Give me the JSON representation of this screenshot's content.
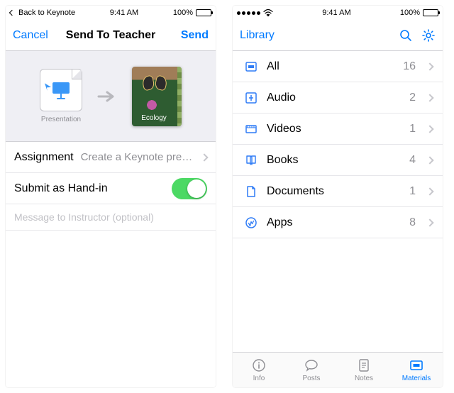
{
  "colors": {
    "tint": "#007aff",
    "toggle_on": "#4cd964",
    "gray": "#8e8e93"
  },
  "left": {
    "status": {
      "back_app": "Back to Keynote",
      "time": "9:41 AM",
      "battery_pct": "100%"
    },
    "nav": {
      "cancel": "Cancel",
      "title": "Send To Teacher",
      "send": "Send"
    },
    "transfer": {
      "source_caption": "Presentation",
      "source_icon": "keynote-icon",
      "arrow_icon": "arrow-right-icon",
      "dest_label": "Ecology",
      "dest_image_alt": "butterfly-flower-course-cover"
    },
    "rows": {
      "assignment_label": "Assignment",
      "assignment_detail": "Create a Keynote presentatio...",
      "submit_label": "Submit as Hand-in",
      "submit_on": true
    },
    "message_placeholder": "Message to Instructor (optional)"
  },
  "right": {
    "status": {
      "time": "9:41 AM",
      "battery_pct": "100%"
    },
    "nav": {
      "title": "Library",
      "search_icon": "search-icon",
      "settings_icon": "gear-icon"
    },
    "items": [
      {
        "icon": "all-icon",
        "label": "All",
        "count": "16"
      },
      {
        "icon": "audio-icon",
        "label": "Audio",
        "count": "2"
      },
      {
        "icon": "videos-icon",
        "label": "Videos",
        "count": "1"
      },
      {
        "icon": "books-icon",
        "label": "Books",
        "count": "4"
      },
      {
        "icon": "documents-icon",
        "label": "Documents",
        "count": "1"
      },
      {
        "icon": "apps-icon",
        "label": "Apps",
        "count": "8"
      }
    ],
    "tabs": [
      {
        "icon": "info-icon",
        "label": "Info",
        "active": false
      },
      {
        "icon": "posts-icon",
        "label": "Posts",
        "active": false
      },
      {
        "icon": "notes-icon",
        "label": "Notes",
        "active": false
      },
      {
        "icon": "materials-icon",
        "label": "Materials",
        "active": true
      }
    ]
  }
}
